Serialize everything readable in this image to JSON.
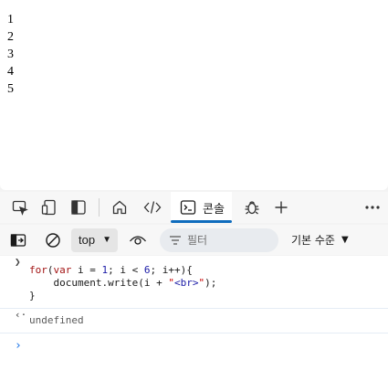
{
  "page": {
    "lines": [
      "1",
      "2",
      "3",
      "4",
      "5"
    ]
  },
  "devtools": {
    "tabs": {
      "console_label": "콘솔"
    },
    "console_toolbar": {
      "context": "top",
      "filter_placeholder": "필터",
      "levels_label": "기본 수준"
    },
    "console": {
      "code": {
        "l1_kw": "for",
        "l1_open": "(",
        "l1_var": "var",
        "l1_mid1": " i = ",
        "l1_n1": "1",
        "l1_mid2": "; i < ",
        "l1_n2": "6",
        "l1_end": "; i++){",
        "l2_pre": "    document.write(i + ",
        "l2_q1": "\"",
        "l2_str": "<br>",
        "l2_q2": "\"",
        "l2_end": ");",
        "l3": "}"
      },
      "result": "undefined"
    },
    "accent_color": "#0f6cbd"
  }
}
